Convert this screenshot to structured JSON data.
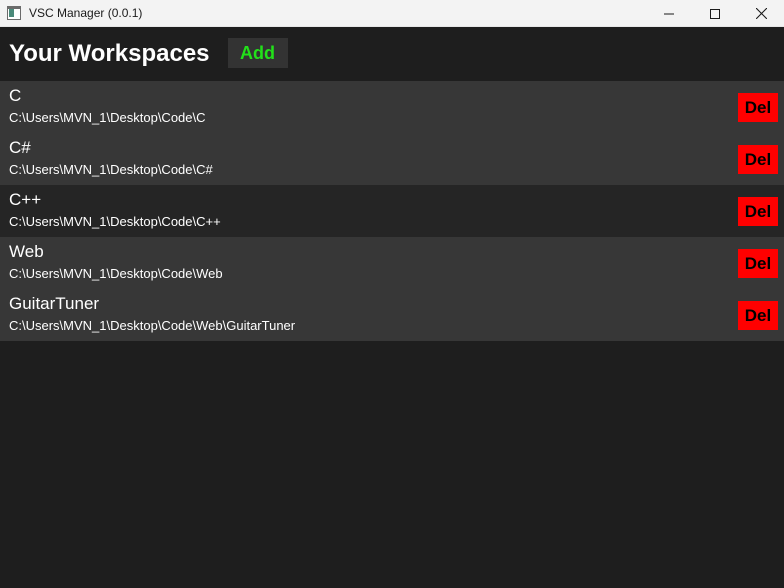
{
  "window": {
    "title": "VSC Manager (0.0.1)",
    "controls": {
      "minimize_icon": "minimize-icon",
      "maximize_icon": "maximize-icon",
      "close_icon": "close-icon"
    }
  },
  "header": {
    "title": "Your Workspaces",
    "add_label": "Add"
  },
  "colors": {
    "background": "#1e1e1e",
    "row_light": "#373737",
    "row_dark": "#252525",
    "add_text": "#22e01a",
    "delete_bg": "#ff0000"
  },
  "workspaces": [
    {
      "name": "C",
      "path": "C:\\Users\\MVN_1\\Desktop\\Code\\C",
      "delete_label": "Del"
    },
    {
      "name": "C#",
      "path": "C:\\Users\\MVN_1\\Desktop\\Code\\C#",
      "delete_label": "Del"
    },
    {
      "name": "C++",
      "path": "C:\\Users\\MVN_1\\Desktop\\Code\\C++",
      "delete_label": "Del"
    },
    {
      "name": "Web",
      "path": "C:\\Users\\MVN_1\\Desktop\\Code\\Web",
      "delete_label": "Del"
    },
    {
      "name": "GuitarTuner",
      "path": "C:\\Users\\MVN_1\\Desktop\\Code\\Web\\GuitarTuner",
      "delete_label": "Del"
    }
  ]
}
